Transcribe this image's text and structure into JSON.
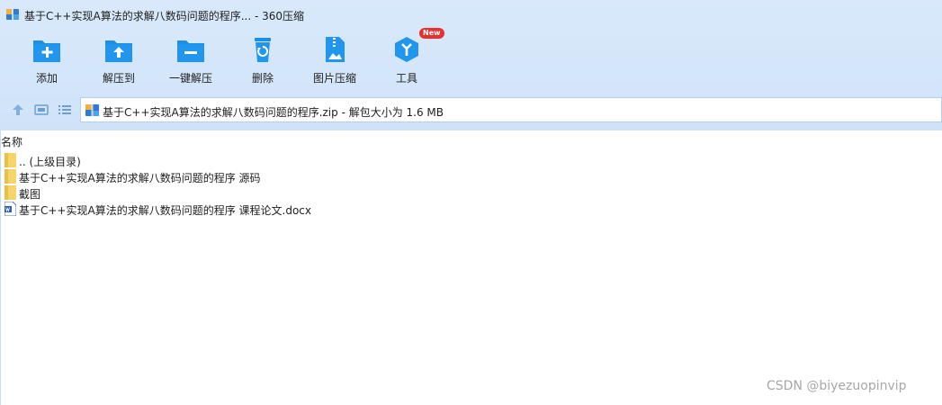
{
  "window": {
    "title": "基于C++实现A算法的求解八数码问题的程序... - 360压缩"
  },
  "toolbar": {
    "items": [
      {
        "label": "添加",
        "icon": "add-icon"
      },
      {
        "label": "解压到",
        "icon": "extract-to-icon"
      },
      {
        "label": "一键解压",
        "icon": "one-click-extract-icon"
      },
      {
        "label": "删除",
        "icon": "delete-icon"
      },
      {
        "label": "图片压缩",
        "icon": "image-compress-icon"
      },
      {
        "label": "工具",
        "icon": "tools-icon",
        "badge": "New"
      }
    ]
  },
  "address": {
    "path": "基于C++实现A算法的求解八数码问题的程序.zip - 解包大小为 1.6 MB"
  },
  "list": {
    "column_name": "名称",
    "items": [
      {
        "name": ".. (上级目录)",
        "type": "parent-folder"
      },
      {
        "name": "基于C++实现A算法的求解八数码问题的程序 源码",
        "type": "folder"
      },
      {
        "name": "截图",
        "type": "folder"
      },
      {
        "name": "基于C++实现A算法的求解八数码问题的程序 课程论文.docx",
        "type": "docx"
      }
    ]
  },
  "watermark": "CSDN @biyezuopinvip",
  "colors": {
    "accent": "#1a8fe3",
    "chrome": "#d7e8fb",
    "folder": "#f6d36b",
    "badge": "#e8312f"
  }
}
